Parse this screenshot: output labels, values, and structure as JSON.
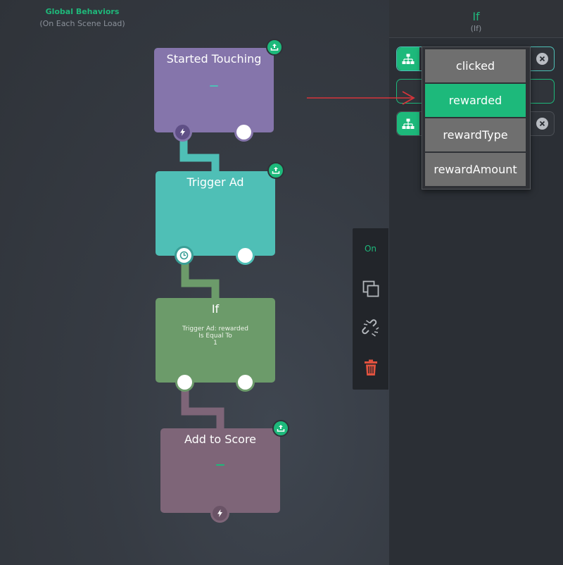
{
  "canvas": {
    "title": "Global Behaviors",
    "subtitle": "(On Each Scene Load)"
  },
  "nodes": {
    "started_touching": {
      "title": "Started Touching",
      "color": "#8575ab"
    },
    "trigger_ad": {
      "title": "Trigger Ad",
      "color": "#4fbfb6"
    },
    "if": {
      "title": "If",
      "body_line1": "Trigger Ad: rewarded",
      "body_line2": "Is Equal To",
      "body_line3": "1",
      "color": "#6c9b6a"
    },
    "add_to_score": {
      "title": "Add to Score",
      "color": "#7e6578"
    }
  },
  "toolbar": {
    "on_label": "On",
    "icons": [
      "copy-icon",
      "unlink-icon",
      "trash-icon"
    ]
  },
  "panel": {
    "title": "If",
    "subtitle": "(If)"
  },
  "dropdown": {
    "options": [
      "clicked",
      "rewarded",
      "rewardType",
      "rewardAmount"
    ],
    "selected": "rewarded"
  },
  "colors": {
    "accent": "#1db97b",
    "delete": "#e0523f",
    "arrow": "#d6343a"
  }
}
